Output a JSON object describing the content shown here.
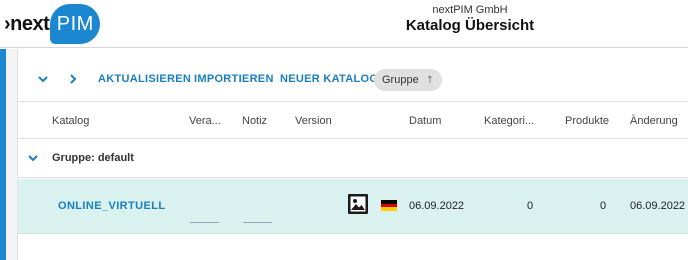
{
  "header": {
    "logo_prefix": "›next",
    "logo_suffix": "PIM",
    "company": "nextPIM GmbH",
    "title": "Katalog Übersicht"
  },
  "toolbar": {
    "collapse_icon": "chevron-down-icon",
    "expand_icon": "chevron-right-icon",
    "refresh_label": "AKTUALISIEREN",
    "import_label": "IMPORTIEREN",
    "new_catalog_label": "NEUER KATALOG",
    "group_chip_label": "Gruppe",
    "group_chip_icon": "↑"
  },
  "table": {
    "columns": [
      "Katalog",
      "Vera...",
      "Notiz",
      "Version",
      "Datum",
      "Kategori...",
      "Produkte",
      "Änderung"
    ],
    "group_label": "Gruppe: default",
    "rows": [
      {
        "katalog": "ONLINE_VIRTUELL",
        "vera": "",
        "notiz": "",
        "version_icon": "image-icon",
        "flag": "de-flag",
        "datum": "06.09.2022",
        "kategorien": "0",
        "produkte": "0",
        "aenderung": "06.09.2022"
      }
    ]
  },
  "colors": {
    "accent": "#1a87d0",
    "link": "#1a7fc1",
    "row_highlight": "#d9f1ef",
    "chip_bg": "#e0e0e0"
  }
}
